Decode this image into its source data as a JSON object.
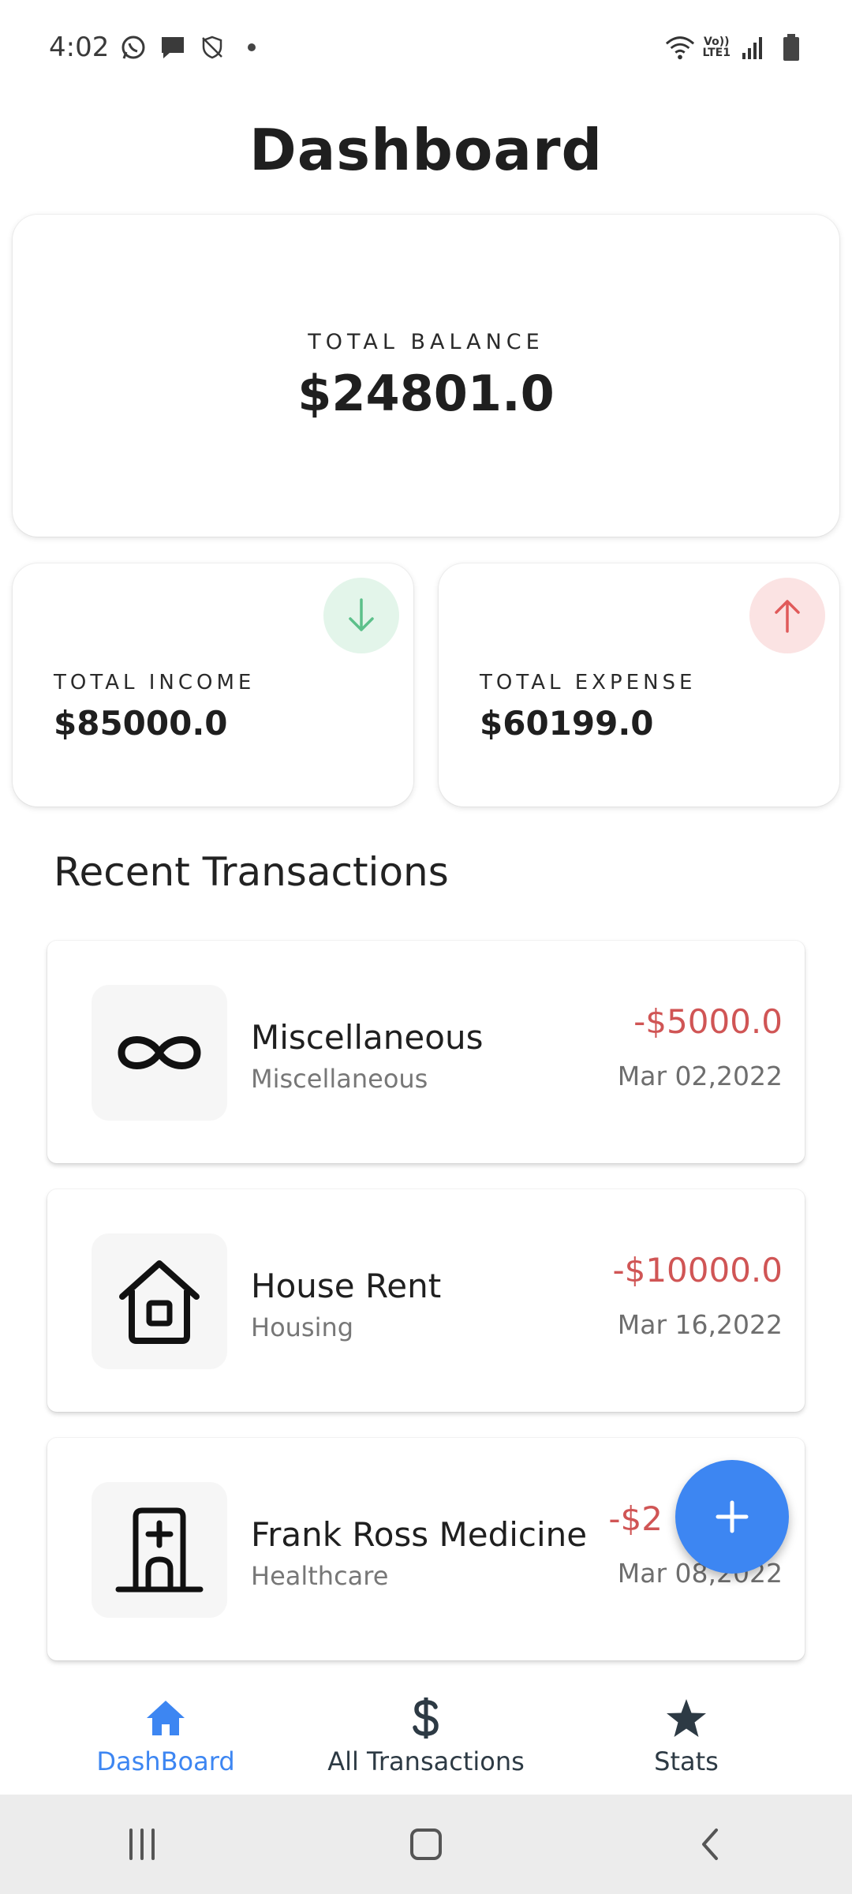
{
  "status": {
    "time": "4:02",
    "network_line1": "Vo))",
    "network_line2": "LTE1"
  },
  "header": {
    "title": "Dashboard"
  },
  "balance": {
    "label": "TOTAL BALANCE",
    "value": "$24801.0"
  },
  "income": {
    "label": "TOTAL INCOME",
    "value": "$85000.0",
    "color": "#5cc08a"
  },
  "expense": {
    "label": "TOTAL EXPENSE",
    "value": "$60199.0",
    "color": "#e05a5a"
  },
  "recent": {
    "title": "Recent Transactions",
    "items": [
      {
        "name": "Miscellaneous",
        "category": "Miscellaneous",
        "amount": "-$5000.0",
        "date": "Mar 02,2022",
        "icon": "infinity-icon"
      },
      {
        "name": "House Rent",
        "category": "Housing",
        "amount": "-$10000.0",
        "date": "Mar 16,2022",
        "icon": "house-icon"
      },
      {
        "name": "Frank Ross Medicine",
        "category": "Healthcare",
        "amount": "-$2",
        "date": "Mar 08,2022",
        "icon": "hospital-icon"
      }
    ]
  },
  "nav": {
    "items": [
      {
        "label": "DashBoard",
        "icon": "home-icon",
        "active": true
      },
      {
        "label": "All Transactions",
        "icon": "dollar-icon",
        "active": false
      },
      {
        "label": "Stats",
        "icon": "star-icon",
        "active": false
      }
    ]
  },
  "colors": {
    "accent": "#3d86f2",
    "negative": "#d05555"
  }
}
